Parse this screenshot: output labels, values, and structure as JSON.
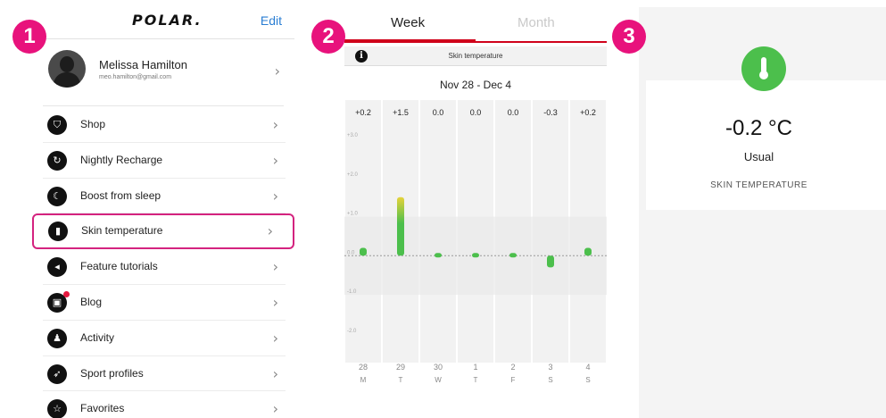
{
  "steps": [
    "1",
    "2",
    "3"
  ],
  "menu_screen": {
    "logo": "POLAR.",
    "edit_label": "Edit",
    "profile": {
      "name": "Melissa Hamilton",
      "email": "meo.hamilton@gmail.com"
    },
    "items": [
      {
        "label": "Shop",
        "icon": "shop-icon"
      },
      {
        "label": "Nightly Recharge",
        "icon": "nightly-recharge-icon"
      },
      {
        "label": "Boost from sleep",
        "icon": "moon-icon"
      },
      {
        "label": "Skin temperature",
        "icon": "thermometer-icon",
        "highlighted": true
      },
      {
        "label": "Feature tutorials",
        "icon": "tutorial-icon"
      },
      {
        "label": "Blog",
        "icon": "blog-icon",
        "notification": true
      },
      {
        "label": "Activity",
        "icon": "activity-icon"
      },
      {
        "label": "Sport profiles",
        "icon": "sport-profiles-icon"
      },
      {
        "label": "Favorites",
        "icon": "star-icon"
      }
    ],
    "highlight_color": "#d4237f"
  },
  "chart_screen": {
    "tabs": {
      "week": "Week",
      "month": "Month",
      "active": "week"
    },
    "info_title": "Skin temperature",
    "date_range": "Nov 28 - Dec 4",
    "accent_color": "#d0021b"
  },
  "chart_data": {
    "type": "bar",
    "title": "",
    "xlabel": "",
    "ylabel": "",
    "ylim": [
      -2.6,
      3.3
    ],
    "yticks": [
      "+3.0",
      "+2.0",
      "+1.0",
      "0.0",
      "-1.0",
      "-2.0"
    ],
    "ytick_values": [
      3,
      2,
      1,
      0,
      -1,
      -2
    ],
    "usual_range": [
      -1.0,
      1.0
    ],
    "categories": [
      {
        "day": "28",
        "weekday": "M"
      },
      {
        "day": "29",
        "weekday": "T"
      },
      {
        "day": "30",
        "weekday": "W"
      },
      {
        "day": "1",
        "weekday": "T"
      },
      {
        "day": "2",
        "weekday": "F"
      },
      {
        "day": "3",
        "weekday": "S"
      },
      {
        "day": "4",
        "weekday": "S"
      }
    ],
    "value_labels": [
      "+0.2",
      "+1.5",
      "0.0",
      "0.0",
      "0.0",
      "-0.3",
      "+0.2"
    ],
    "values": [
      0.2,
      1.5,
      0.0,
      0.0,
      0.0,
      -0.3,
      0.2
    ],
    "bar_color": "#4cbf4c",
    "high_color": "#e6d23a",
    "grid": true
  },
  "detail_screen": {
    "value": "-0.2 °C",
    "status": "Usual",
    "caption": "SKIN TEMPERATURE",
    "icon": "thermometer-icon",
    "icon_color": "#4cbf4c"
  }
}
